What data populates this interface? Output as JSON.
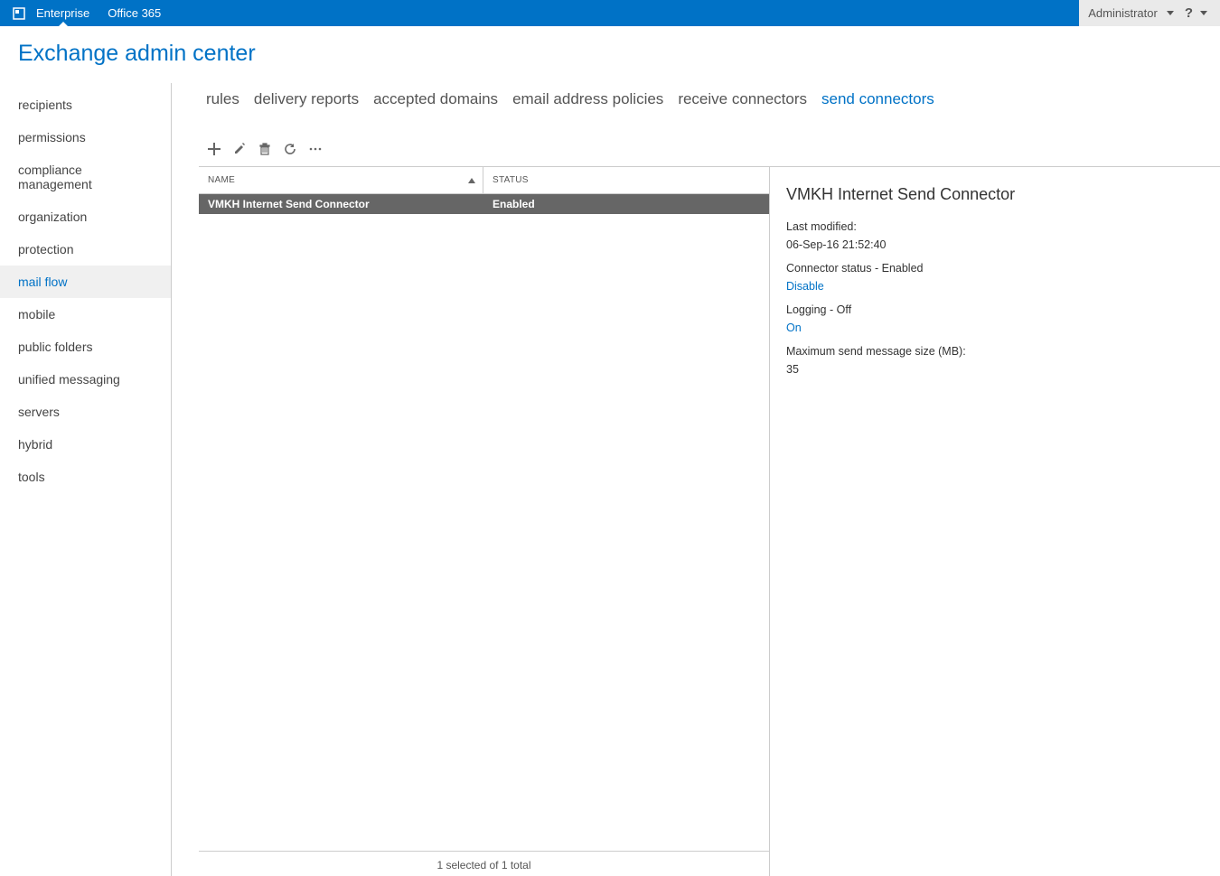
{
  "topbar": {
    "tab_enterprise": "Enterprise",
    "tab_office365": "Office 365",
    "admin_label": "Administrator"
  },
  "page_title": "Exchange admin center",
  "sidebar": {
    "items": [
      {
        "label": "recipients"
      },
      {
        "label": "permissions"
      },
      {
        "label": "compliance management"
      },
      {
        "label": "organization"
      },
      {
        "label": "protection"
      },
      {
        "label": "mail flow"
      },
      {
        "label": "mobile"
      },
      {
        "label": "public folders"
      },
      {
        "label": "unified messaging"
      },
      {
        "label": "servers"
      },
      {
        "label": "hybrid"
      },
      {
        "label": "tools"
      }
    ],
    "active_index": 5
  },
  "tabs": {
    "items": [
      {
        "label": "rules"
      },
      {
        "label": "delivery reports"
      },
      {
        "label": "accepted domains"
      },
      {
        "label": "email address policies"
      },
      {
        "label": "receive connectors"
      },
      {
        "label": "send connectors"
      }
    ],
    "active_index": 5
  },
  "list": {
    "columns": {
      "name": "NAME",
      "status": "STATUS"
    },
    "rows": [
      {
        "name": "VMKH Internet Send Connector",
        "status": "Enabled"
      }
    ],
    "selected_index": 0
  },
  "details": {
    "title": "VMKH Internet Send Connector",
    "last_modified_label": "Last modified:",
    "last_modified_value": "06-Sep-16 21:52:40",
    "connector_status": "Connector status - Enabled",
    "disable_link": "Disable",
    "logging": "Logging - Off",
    "on_link": "On",
    "max_size_label": "Maximum send message size (MB):",
    "max_size_value": "35"
  },
  "footer": {
    "status": "1 selected of 1 total"
  }
}
